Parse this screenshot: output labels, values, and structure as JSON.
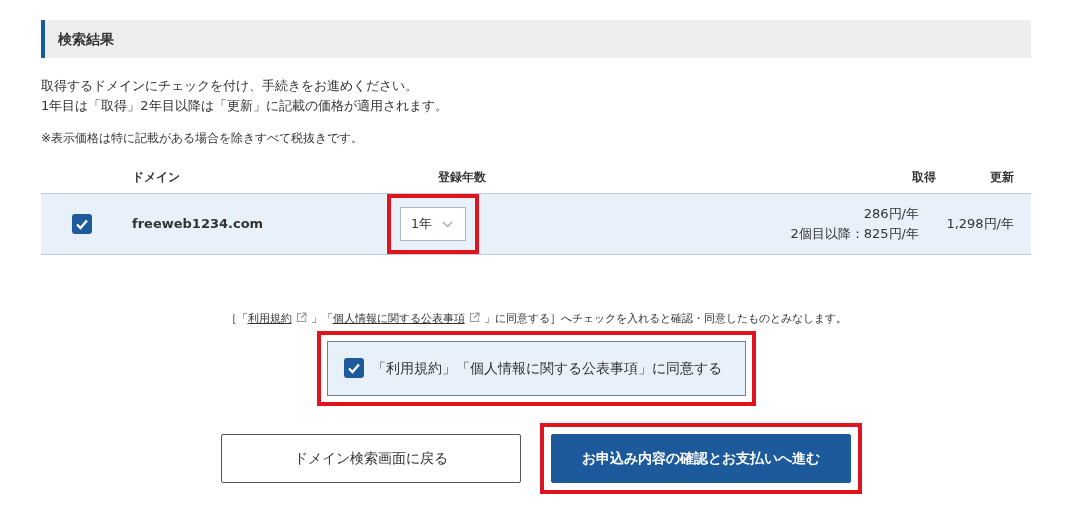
{
  "section_title": "検索結果",
  "intro_lines": [
    "取得するドメインにチェックを付け、手続きをお進めください。",
    "1年目は「取得」2年目以降は「更新」に記載の価格が適用されます。"
  ],
  "tax_note": "※表示価格は特に記載がある場合を除きすべて税抜きです。",
  "table": {
    "columns": [
      "ドメイン",
      "登録年数",
      "取得",
      "更新"
    ],
    "rows": [
      {
        "checked": true,
        "domain": "freeweb1234.com",
        "years": "1年",
        "years_highlighted": true,
        "price_lines": [
          "286円/年",
          "2個目以降：825円/年"
        ],
        "renewal": "1,298円/年"
      }
    ]
  },
  "consent_notice": [
    {
      "kind": "text",
      "text": "［「"
    },
    {
      "kind": "link",
      "text": "利用規約"
    },
    {
      "kind": "text",
      "text": "」「"
    },
    {
      "kind": "link",
      "text": "個人情報に関する公表事項"
    },
    {
      "kind": "text",
      "text": "」に同意する］へチェックを入れると確認・同意したものとみなします。"
    }
  ],
  "consent_checkbox": {
    "label": "「利用規約」「個人情報に関する公表事項」に同意する",
    "checked": true,
    "highlighted": true
  },
  "buttons": [
    {
      "kind": "secondary",
      "label": "ドメイン検索画面に戻る",
      "highlighted": false
    },
    {
      "kind": "primary",
      "label": "お申込み内容の確認とお支払いへ進む",
      "highlighted": true
    }
  ]
}
